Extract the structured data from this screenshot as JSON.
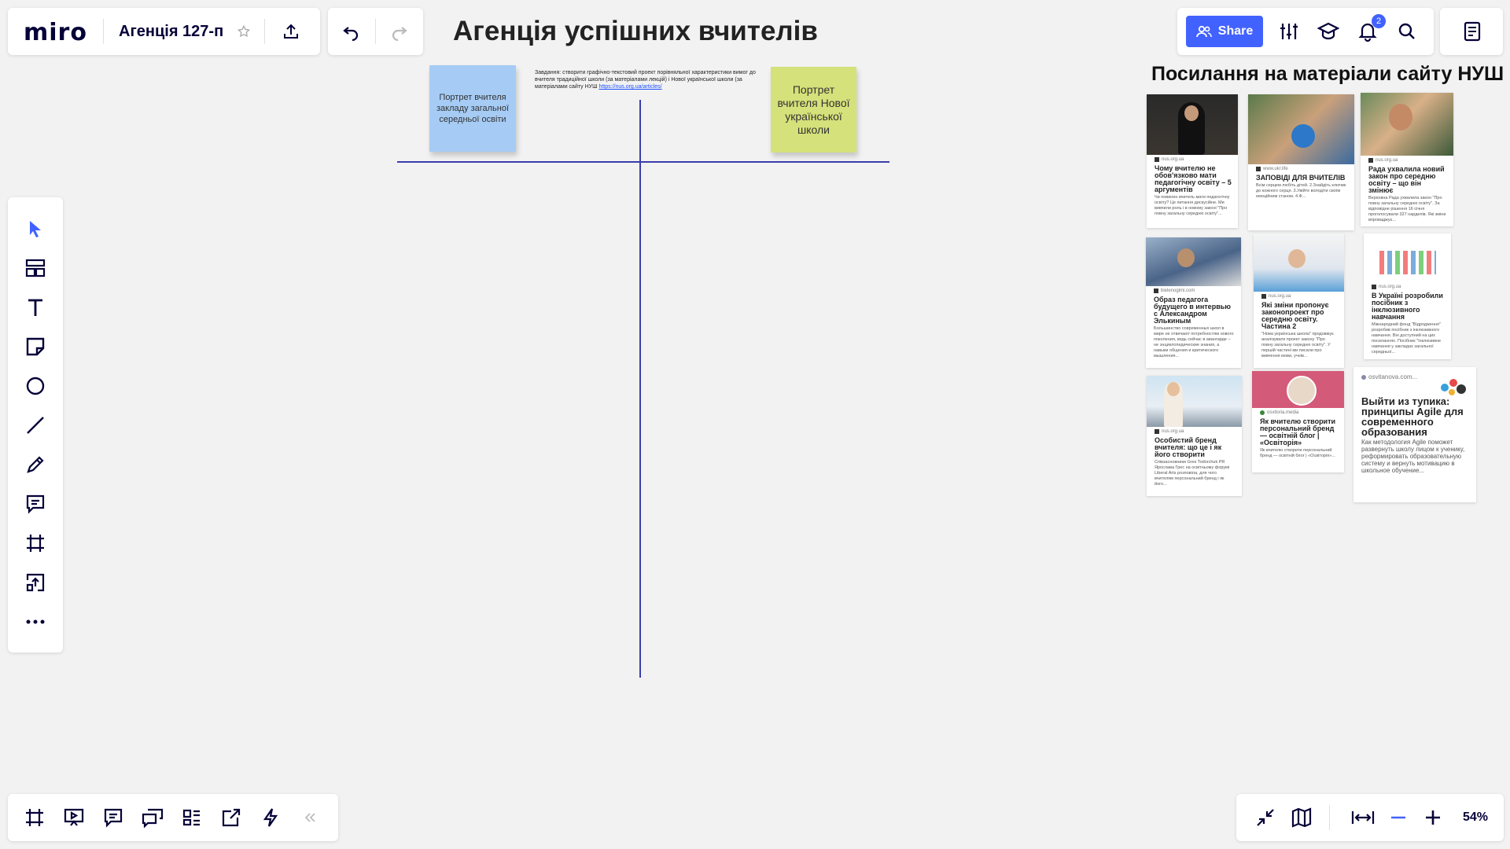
{
  "app": {
    "logo": "miro",
    "board_name": "Агенція 127-п"
  },
  "header": {
    "share_label": "Share",
    "notifications_count": "2"
  },
  "canvas": {
    "title": "Агенція успішних вчителів",
    "sticky_left": "Портрет вчителя закладу загальної середньої освіти",
    "sticky_right": "Портрет вчителя Нової української школи",
    "task_text": "Завдання: створити графічно-текстовий проект порівняльної характеристики вимог до вчителя традиційної школи (за матеріалами лекцій) і Нової української школи (за матеріалами сайту НУШ",
    "task_link": "https://nus.org.ua/articles/",
    "links_title": "Посилання на матеріали сайту НУШ",
    "colors": {
      "sticky_blue": "#a6ccf5",
      "sticky_green": "#d5e17a",
      "line": "#3b3cae",
      "accent": "#4262ff"
    }
  },
  "cards": [
    {
      "source": "nus.org.ua",
      "title": "Чому вчителю не обов'язково мати педагогічну освіту – 5 аргументів",
      "desc": "Чи повинен вчитель мати педагогічну освіту? Це питання дискусійне. Ми вивчили роль і в новому законі \"Про повну загальну середню освіту\"..."
    },
    {
      "source": "www.ukr.life",
      "title": "ЗАПОВІДІ ДЛЯ ВЧИТЕЛІВ",
      "desc": "Всім серцем любіть дітей. 2.Знайдіть ключик до кожного серця. 3.Увійте володіти своїм емоційним станом. 4.Ф..."
    },
    {
      "source": "nus.org.ua",
      "title": "Рада ухвалила новий закон про середню освіту – що він змінює",
      "desc": "Верховна Рада ухвалила закон \"Про повну загальну середню освіту\". За відповідне рішення 16 січня проголосували 327 нардепів. Які зміни впроваджує..."
    },
    {
      "source": "bielenogimi.com",
      "title": "Образ педагога будущего в интервью с Александром Элькиным",
      "desc": "Большинство современных школ в мире не отвечают потребностям нового поколения, ведь сейчас в авангарде – не энциклопедические знания, а навыки общения и критического мышления..."
    },
    {
      "source": "nus.org.ua",
      "title": "Які зміни пропонує законопроект про середню освіту. Частина 2",
      "desc": "\"Нова українська школа\" продовжує аналізувати проект закону \"Про повну загальну середню освіту\". У першій частині ми писали про вивчення мови, учнів..."
    },
    {
      "source": "nus.org.ua",
      "title": "В Україні розробили посібник з інклюзивного навчання",
      "desc": "Міжнародний фонд \"Відродження\" розробив посібник з інклюзивного навчання. Він доступний на цих посиланнях. Посібник \"Інклюзивне навчання у закладах загальної середньої..."
    },
    {
      "source": "nus.org.ua",
      "title": "Особистий бренд вчителя: що це і як його створити",
      "desc": "Співзасновники Gres Todorchuk PR Ярослава Грес на освітньому форумі Liberal Arts розповіла, для чого вчителям персональний бренд і як його..."
    },
    {
      "source": "osvitoria.media",
      "title": "Як вчителю створити персональний бренд — освітній блог | «Освіторія»",
      "desc": "Як вчителю створити персональний бренд — освітній блог | «Освіторія»..."
    },
    {
      "source": "osvitanova.com...",
      "title": "Выйти из тупика: принципы Agile для современного образования",
      "desc": "Как методология Agile поможет развернуть школу лицом к ученику, реформировать образовательную систему и вернуть мотивацию в школьное обучение..."
    }
  ],
  "zoom": {
    "value": "54%"
  }
}
